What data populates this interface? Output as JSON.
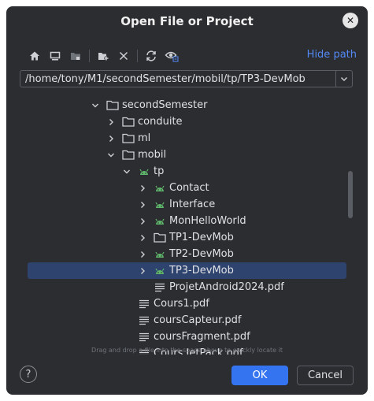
{
  "dialog": {
    "title": "Open File or Project",
    "close_glyph": "✕"
  },
  "toolbar": {
    "buttons": [
      {
        "icon": "home-icon"
      },
      {
        "icon": "desktop-icon"
      },
      {
        "icon": "project-folder-icon"
      },
      {
        "icon": "new-folder-icon"
      },
      {
        "icon": "delete-icon"
      },
      {
        "icon": "refresh-icon"
      },
      {
        "icon": "show-hidden-icon"
      }
    ],
    "hide_path_label": "Hide path"
  },
  "path": {
    "value": "/home/tony/M1/secondSemester/mobil/tp/TP3-DevMob"
  },
  "tree": {
    "items": [
      {
        "label": "secondSemester",
        "icon": "folder",
        "expanded": true
      },
      {
        "label": "conduite",
        "icon": "folder",
        "expanded": false
      },
      {
        "label": "ml",
        "icon": "folder",
        "expanded": false
      },
      {
        "label": "mobil",
        "icon": "folder",
        "expanded": true
      },
      {
        "label": "tp",
        "icon": "android",
        "expanded": true
      },
      {
        "label": "Contact",
        "icon": "android",
        "expanded": false
      },
      {
        "label": "Interface",
        "icon": "android",
        "expanded": false
      },
      {
        "label": "MonHelloWorld",
        "icon": "android",
        "expanded": false
      },
      {
        "label": "TP1-DevMob",
        "icon": "folder",
        "expanded": false
      },
      {
        "label": "TP2-DevMob",
        "icon": "android",
        "expanded": false
      },
      {
        "label": "TP3-DevMob",
        "icon": "android",
        "expanded": false,
        "selected": true
      },
      {
        "label": "ProjetAndroid2024.pdf",
        "icon": "file"
      },
      {
        "label": "Cours1.pdf",
        "icon": "file"
      },
      {
        "label": "coursCapteur.pdf",
        "icon": "file"
      },
      {
        "label": "coursFragment.pdf",
        "icon": "file"
      },
      {
        "label": "Cours.JetPack.pdf",
        "icon": "file"
      }
    ]
  },
  "hint": "Drag and drop a file into the space above to quickly locate it",
  "footer": {
    "help_label": "?",
    "ok_label": "OK",
    "cancel_label": "Cancel"
  },
  "colors": {
    "background": "#2b2d30",
    "accent": "#3574f0",
    "link": "#548af7",
    "selection": "#2e436e",
    "android_green": "#5fb86b"
  }
}
